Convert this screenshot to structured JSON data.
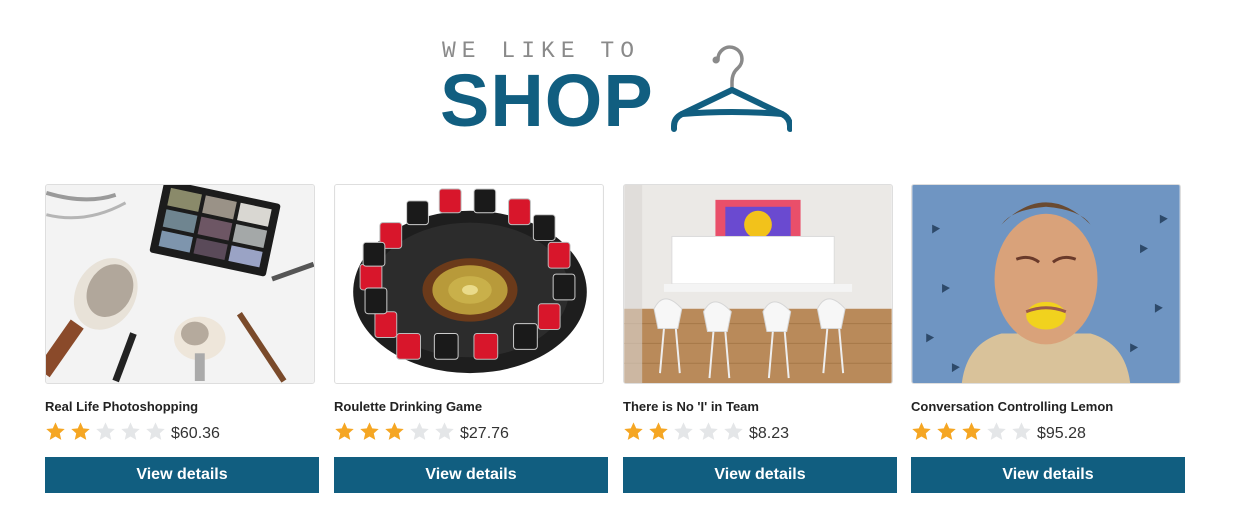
{
  "header": {
    "tagline": "WE LIKE TO",
    "brand": "SHOP",
    "logo_icon": "hanger-icon"
  },
  "colors": {
    "brand": "#115e80",
    "star_filled": "#f5a623",
    "star_empty": "#e4e6e8",
    "button_text": "#ffffff"
  },
  "products": [
    {
      "title": "Real Life Photoshopping",
      "rating": 2,
      "max_rating": 5,
      "price": "$60.36",
      "button": "View details",
      "image": "makeup-brushes-photo"
    },
    {
      "title": "Roulette Drinking Game",
      "rating": 3,
      "max_rating": 5,
      "price": "$27.76",
      "button": "View details",
      "image": "roulette-shot-glasses-photo"
    },
    {
      "title": "There is No 'I' in Team",
      "rating": 2,
      "max_rating": 5,
      "price": "$8.23",
      "button": "View details",
      "image": "team-letters-office-photo"
    },
    {
      "title": "Conversation Controlling Lemon",
      "rating": 3,
      "max_rating": 5,
      "price": "$95.28",
      "button": "View details",
      "image": "man-lemon-mouth-photo"
    }
  ]
}
